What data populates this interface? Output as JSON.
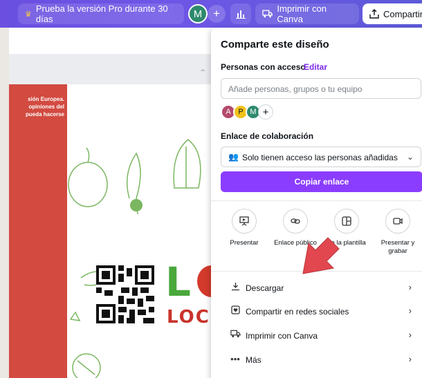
{
  "toolbar": {
    "pro_label": "Prueba la versión Pro durante 30 días",
    "avatar_initial": "M",
    "plus_label": "+",
    "print_label": "Imprimir con Canva",
    "share_label": "Compartir"
  },
  "design": {
    "red_text_lines": [
      "sión Europea.",
      "opiniones del",
      "pueda hacerse"
    ],
    "logo_letter": "L",
    "logo_word": "LOC"
  },
  "share_panel": {
    "title": "Comparte este diseño",
    "access_label": "Personas con acceso",
    "edit_label": "Editar",
    "input_placeholder": "Añade personas, grupos o tu equipo",
    "avatars": [
      "A",
      "P",
      "M"
    ],
    "add_avatar": "+",
    "link_label": "Enlace de colaboración",
    "link_option": "Solo tienen acceso las personas añadidas",
    "copy_button": "Copiar enlace",
    "options": [
      {
        "label": "Presentar",
        "icon": "present-icon"
      },
      {
        "label": "Enlace público",
        "icon": "link-icon"
      },
      {
        "label": "de la plantilla",
        "icon": "template-icon"
      },
      {
        "label": "Presentar y grabar",
        "icon": "record-icon"
      }
    ],
    "actions": [
      {
        "label": "Descargar",
        "icon": "download-icon"
      },
      {
        "label": "Compartir en redes sociales",
        "icon": "social-icon"
      },
      {
        "label": "Imprimir con Canva",
        "icon": "truck-icon"
      },
      {
        "label": "Más",
        "icon": "more-icon"
      }
    ]
  },
  "colors": {
    "toolbar": "#6a4fe0",
    "accent": "#8b3dff",
    "arrow": "#e2474f"
  }
}
